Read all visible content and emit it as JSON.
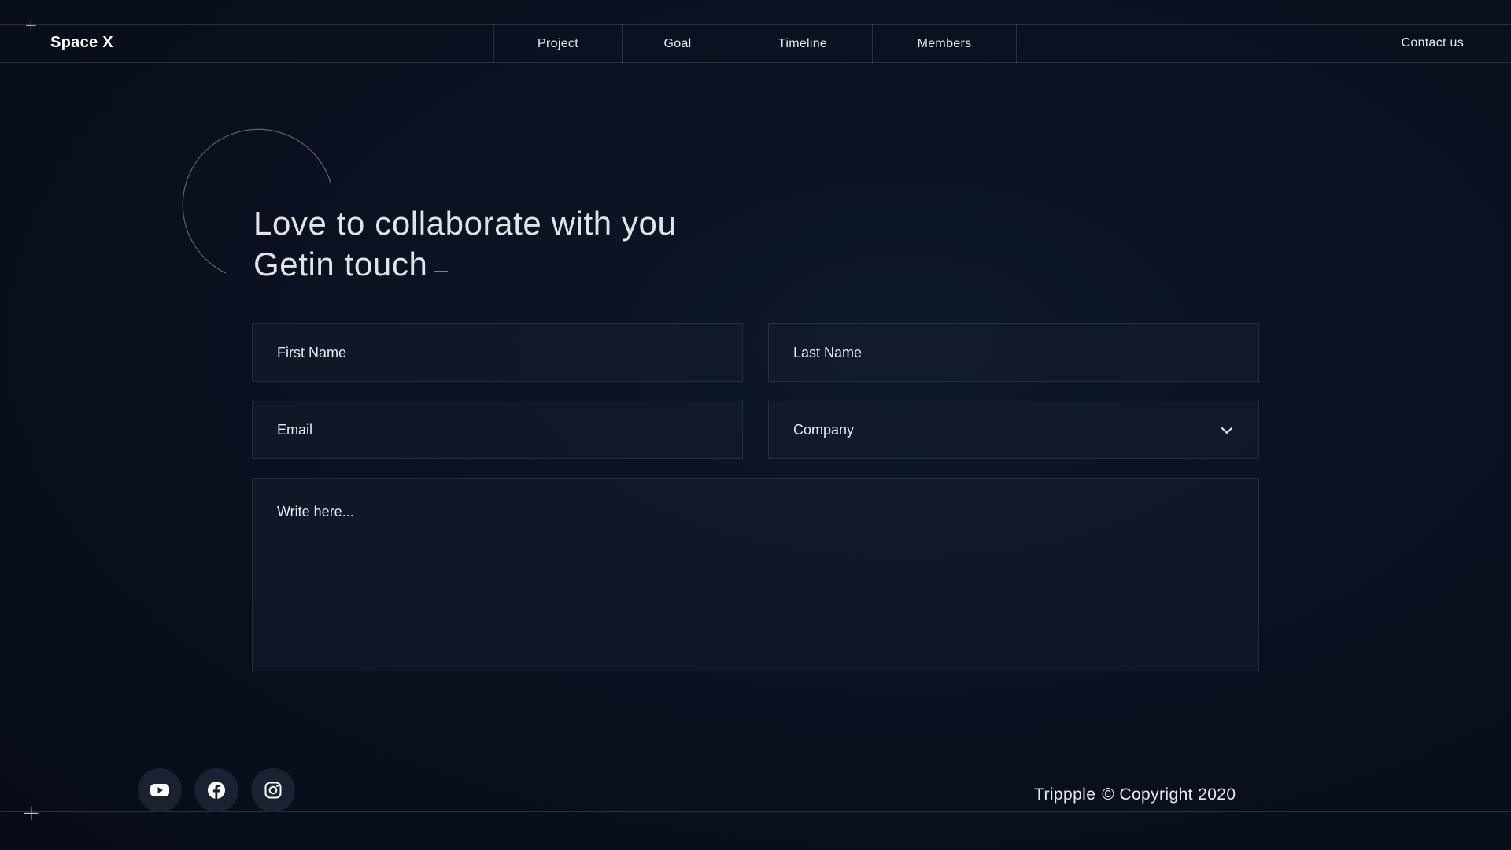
{
  "header": {
    "logo": "Space X",
    "nav": [
      {
        "label": "Project"
      },
      {
        "label": "Goal"
      },
      {
        "label": "Timeline"
      },
      {
        "label": "Members"
      }
    ],
    "contact_label": "Contact us"
  },
  "hero": {
    "line1": "Love to collaborate with you",
    "line2": "Getin touch"
  },
  "form": {
    "first_name_placeholder": "First Name",
    "last_name_placeholder": "Last Name",
    "email_placeholder": "Email",
    "company_value": "Company",
    "message_placeholder": "Write here..."
  },
  "social": [
    {
      "icon": "youtube-icon"
    },
    {
      "icon": "facebook-icon"
    },
    {
      "icon": "instagram-icon"
    }
  ],
  "footer": {
    "brand": "Trippple",
    "copyright": "© Copyright 2020"
  },
  "colors": {
    "background": "#0a1120",
    "field_bg": "#161e2d",
    "text": "#e6e9ef",
    "social_bg": "#1a2131"
  }
}
